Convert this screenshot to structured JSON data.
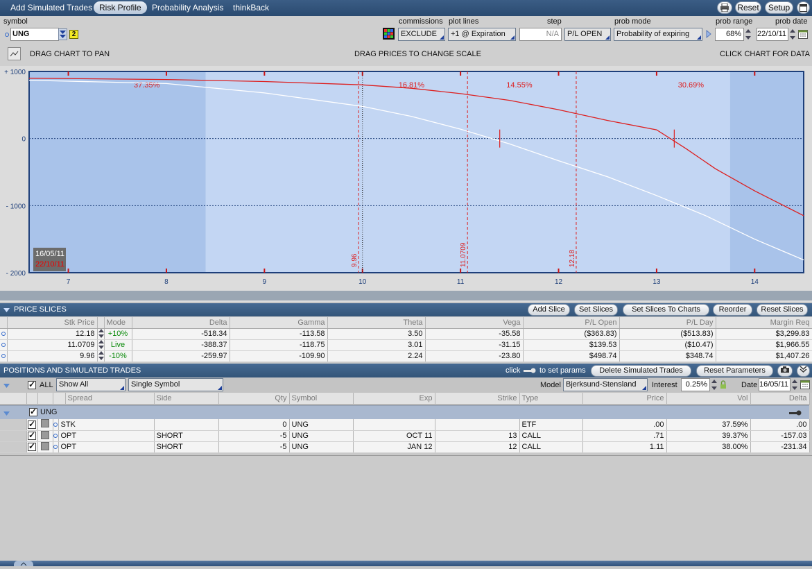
{
  "tabs": [
    "Add Simulated Trades",
    "Risk Profile",
    "Probability Analysis",
    "thinkBack"
  ],
  "top_buttons": {
    "reset": "Reset",
    "setup": "Setup"
  },
  "controls": {
    "symbol_label": "symbol",
    "symbol_value": "UNG",
    "symbol_badge": "2",
    "commissions_label": "commissions",
    "commissions_value": "EXCLUDE",
    "plot_lines_label": "plot lines",
    "plot_lines_value": "+1 @ Expiration",
    "step_label": "step",
    "step_value": "N/A",
    "pl_mode_value": "P/L OPEN",
    "prob_mode_label": "prob mode",
    "prob_mode_value": "Probability of expiring",
    "prob_range_label": "prob range",
    "prob_range_value": "68%",
    "prob_date_label": "prob date",
    "prob_date_value": "22/10/11"
  },
  "chart_hints": {
    "left": "DRAG CHART TO PAN",
    "center": "DRAG PRICES TO CHANGE SCALE",
    "right": "CLICK CHART FOR DATA"
  },
  "chart_data": {
    "type": "line",
    "x_ticks": [
      7,
      8,
      9,
      10,
      11,
      12,
      13,
      14
    ],
    "y_ticks": [
      "+ 1000",
      "0",
      "- 1000",
      "- 2000"
    ],
    "xlim": [
      6.6,
      14.5
    ],
    "ylim": [
      -2000,
      1000
    ],
    "probabilities": [
      {
        "label": "37.35%",
        "x": 7.8
      },
      {
        "label": "16.81%",
        "x": 10.5
      },
      {
        "label": "14.55%",
        "x": 11.6
      },
      {
        "label": "30.69%",
        "x": 13.35
      }
    ],
    "slice_lines": [
      {
        "x": 9.96,
        "label": "9.96"
      },
      {
        "x": 11.0709,
        "label": "11.0709"
      },
      {
        "x": 12.18,
        "label": "12.18"
      }
    ],
    "series": [
      {
        "name": "16/05/11",
        "color": "#ffffff",
        "x": [
          6.6,
          8,
          9,
          10,
          10.5,
          11,
          11.5,
          12,
          12.5,
          13,
          13.5,
          14,
          14.5
        ],
        "y": [
          870,
          820,
          680,
          480,
          330,
          140,
          -80,
          -330,
          -570,
          -850,
          -1150,
          -1500,
          -1810
        ]
      },
      {
        "name": "22/10/11",
        "color": "#dd1f1f",
        "x": [
          6.6,
          8,
          9,
          10,
          10.5,
          11,
          11.5,
          12,
          12.5,
          13,
          13.3,
          13.6,
          14,
          14.5
        ],
        "y": [
          900,
          880,
          850,
          800,
          750,
          670,
          570,
          430,
          270,
          130,
          -150,
          -450,
          -780,
          -1150
        ]
      }
    ],
    "breakevens": [
      {
        "x": 11.4,
        "y": 0,
        "series": "16/05/11"
      },
      {
        "x": 13.18,
        "y": 0,
        "series": "22/10/11"
      }
    ],
    "shaded_range": [
      8.4,
      13.75
    ]
  },
  "price_slices": {
    "title": "PRICE SLICES",
    "buttons": [
      "Add Slice",
      "Set Slices",
      "Set Slices To Charts",
      "Reorder",
      "Reset Slices"
    ],
    "columns": [
      "Stk Price",
      "Mode",
      "Delta",
      "Gamma",
      "Theta",
      "Vega",
      "P/L Open",
      "P/L Day",
      "Margin Req"
    ],
    "rows": [
      [
        "12.18",
        "+10%",
        "-518.34",
        "-113.58",
        "3.50",
        "-35.58",
        "($363.83)",
        "($513.83)",
        "$3,299.83"
      ],
      [
        "11.0709",
        "Live",
        "-388.37",
        "-118.75",
        "3.01",
        "-31.15",
        "$139.53",
        "($10.47)",
        "$1,966.55"
      ],
      [
        "9.96",
        "-10%",
        "-259.97",
        "-109.90",
        "2.24",
        "-23.80",
        "$498.74",
        "$348.74",
        "$1,407.26"
      ]
    ]
  },
  "positions": {
    "title": "POSITIONS AND SIMULATED TRADES",
    "click_text": "click",
    "params_text": "to set params",
    "buttons": [
      "Delete Simulated Trades",
      "Reset Parameters"
    ],
    "all_label": "ALL",
    "filter_value": "Show All",
    "group_value": "Single Symbol",
    "model_label": "Model",
    "model_value": "Bjerksund-Stensland",
    "interest_label": "Interest",
    "interest_value": "0.25%",
    "date_label": "Date",
    "date_value": "16/05/11",
    "columns": [
      "Spread",
      "Side",
      "Qty",
      "Symbol",
      "Exp",
      "Strike",
      "Type",
      "Price",
      "Vol",
      "Delta"
    ],
    "group": "UNG",
    "rows": [
      [
        "STK",
        "",
        "0",
        "UNG",
        "",
        "",
        "ETF",
        ".00",
        "37.59%",
        ".00"
      ],
      [
        "OPT",
        "SHORT",
        "-5",
        "UNG",
        "OCT 11",
        "13",
        "CALL",
        ".71",
        "39.37%",
        "-157.03"
      ],
      [
        "OPT",
        "SHORT",
        "-5",
        "UNG",
        "JAN 12",
        "12",
        "CALL",
        "1.11",
        "38.00%",
        "-231.34"
      ]
    ]
  }
}
